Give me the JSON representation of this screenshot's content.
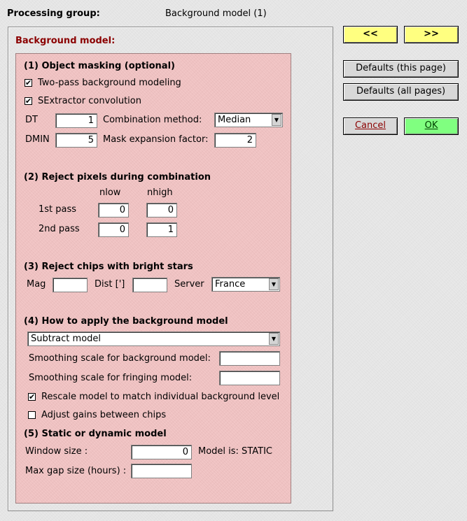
{
  "header": {
    "label": "Processing group:",
    "value": "Background model (1)"
  },
  "section_title": "Background model:",
  "masking": {
    "title": "(1) Object masking (optional)",
    "two_pass": {
      "label": "Two-pass background modeling",
      "checked": true
    },
    "sextractor": {
      "label": "SExtractor convolution",
      "checked": true
    },
    "dt_label": "DT",
    "dt_value": "1",
    "dmin_label": "DMIN",
    "dmin_value": "5",
    "combination_label": "Combination method:",
    "combination_value": "Median",
    "mask_expansion_label": "Mask expansion factor:",
    "mask_expansion_value": "2"
  },
  "reject": {
    "title": "(2) Reject pixels during combination",
    "nlow_label": "nlow",
    "nhigh_label": "nhigh",
    "pass1_label": "1st pass",
    "pass1_nlow": "0",
    "pass1_nhigh": "0",
    "pass2_label": "2nd pass",
    "pass2_nlow": "0",
    "pass2_nhigh": "1"
  },
  "chips": {
    "title": "(3) Reject chips with bright stars",
    "mag_label": "Mag",
    "mag_value": "",
    "dist_label": "Dist [']",
    "dist_value": "",
    "server_label": "Server",
    "server_value": "France"
  },
  "apply": {
    "title": "(4) How to apply the background model",
    "mode_value": "Subtract model",
    "smooth_bg_label": "Smoothing scale for background model:",
    "smooth_bg_value": "",
    "smooth_fr_label": "Smoothing scale for fringing model:",
    "smooth_fr_value": "",
    "rescale": {
      "label": "Rescale model to match individual background level",
      "checked": true
    },
    "adjust_gains": {
      "label": "Adjust gains between chips",
      "checked": false
    }
  },
  "static": {
    "title": "(5) Static or dynamic model",
    "window_label": "Window size :",
    "window_value": "0",
    "model_status": "Model is: STATIC",
    "gap_label": "Max gap size (hours) :",
    "gap_value": ""
  },
  "buttons": {
    "prev": "<<",
    "next": ">>",
    "defaults_page": "Defaults (this page)",
    "defaults_all": "Defaults (all pages)",
    "cancel": "Cancel",
    "ok": "OK"
  },
  "colors": {
    "panel": "#f2c6c6",
    "title_red": "#8b0000",
    "nav_yellow": "#ffff80",
    "ok_green": "#80ff80"
  },
  "icons": {
    "checkmark": "check-icon",
    "dropdown": "chevron-down-icon"
  }
}
